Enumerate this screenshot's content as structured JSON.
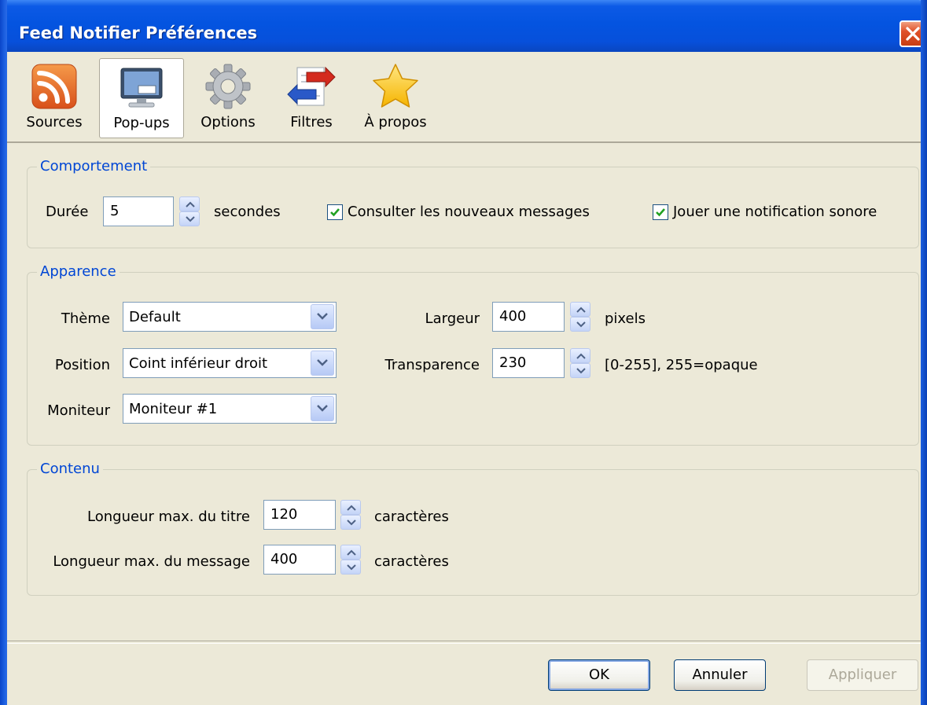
{
  "window": {
    "title": "Feed Notifier Préférences"
  },
  "toolbar": {
    "items": [
      {
        "label": "Sources",
        "icon": "rss-feed-icon"
      },
      {
        "label": "Pop-ups",
        "icon": "monitor-icon",
        "active": true
      },
      {
        "label": "Options",
        "icon": "gear-icon"
      },
      {
        "label": "Filtres",
        "icon": "filter-arrows-icon"
      },
      {
        "label": "À propos",
        "icon": "star-icon"
      }
    ]
  },
  "behavior": {
    "legend": "Comportement",
    "duration_label": "Durée",
    "duration_value": "5",
    "duration_unit": "secondes",
    "check_messages_label": "Consulter les nouveaux messages",
    "check_messages_checked": true,
    "sound_label": "Jouer une notification sonore",
    "sound_checked": true
  },
  "appearance": {
    "legend": "Apparence",
    "theme_label": "Thème",
    "theme_value": "Default",
    "position_label": "Position",
    "position_value": "Coint inférieur droit",
    "monitor_label": "Moniteur",
    "monitor_value": "Moniteur #1",
    "width_label": "Largeur",
    "width_value": "400",
    "width_unit": "pixels",
    "transparency_label": "Transparence",
    "transparency_value": "230",
    "transparency_hint": "[0-255], 255=opaque"
  },
  "content": {
    "legend": "Contenu",
    "title_len_label": "Longueur max. du titre",
    "title_len_value": "120",
    "title_len_unit": "caractères",
    "message_len_label": "Longueur max. du message",
    "message_len_value": "400",
    "message_len_unit": "caractères"
  },
  "buttons": {
    "ok": "OK",
    "cancel": "Annuler",
    "apply": "Appliquer"
  },
  "colors": {
    "titlebar": "#0454e0",
    "legend_text": "#0046d5",
    "dialog_bg": "#ece9d8"
  }
}
